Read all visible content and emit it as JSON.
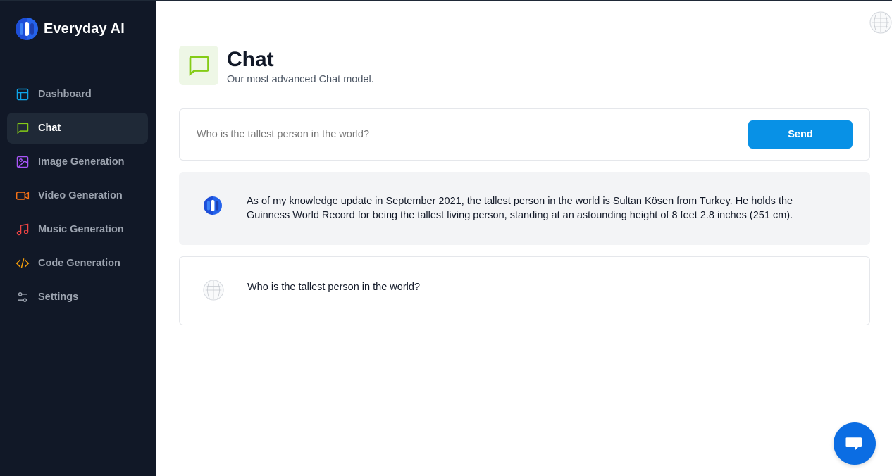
{
  "brand": {
    "name": "Everyday AI"
  },
  "sidebar": {
    "items": [
      {
        "label": "Dashboard",
        "icon": "dashboard-icon",
        "color": "#0ea5e9",
        "active": false
      },
      {
        "label": "Chat",
        "icon": "chat-icon",
        "color": "#84cc16",
        "active": true
      },
      {
        "label": "Image Generation",
        "icon": "image-icon",
        "color": "#a855f7",
        "active": false
      },
      {
        "label": "Video Generation",
        "icon": "video-icon",
        "color": "#f97316",
        "active": false
      },
      {
        "label": "Music Generation",
        "icon": "music-icon",
        "color": "#ef4444",
        "active": false
      },
      {
        "label": "Code Generation",
        "icon": "code-icon",
        "color": "#f59e0b",
        "active": false
      },
      {
        "label": "Settings",
        "icon": "settings-icon",
        "color": "#9ca3af",
        "active": false
      }
    ]
  },
  "header": {
    "title": "Chat",
    "subtitle": "Our most advanced Chat model."
  },
  "prompt": {
    "placeholder": "Who is the tallest person in the world?",
    "send_label": "Send"
  },
  "messages": [
    {
      "role": "assistant",
      "text": "As of my knowledge update in September 2021, the tallest person in the world is Sultan Kösen from Turkey. He holds the Guinness World Record for being the tallest living person, standing at an astounding height of 8 feet 2.8 inches (251 cm)."
    },
    {
      "role": "user",
      "text": "Who is the tallest person in the world?"
    }
  ],
  "colors": {
    "sidebar_bg": "#111827",
    "accent": "#0891e6",
    "chat_green": "#84cc16",
    "support_blue": "#0b6de3"
  }
}
